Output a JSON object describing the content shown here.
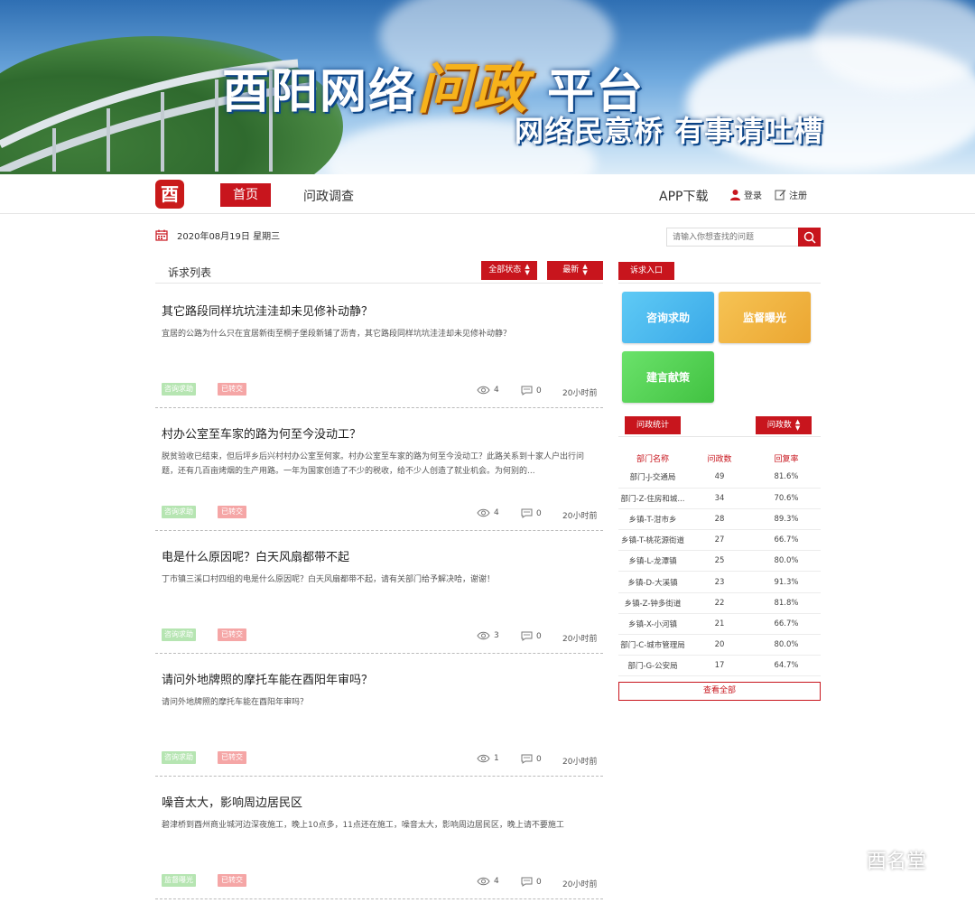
{
  "banner": {
    "title_part1": "酉阳网络",
    "title_highlight": "问政",
    "title_part2": "平台",
    "slogan": "网络民意桥 有事请吐槽"
  },
  "nav": {
    "logo_char": "酉",
    "home": "首页",
    "survey": "问政调查",
    "app_download": "APP下载",
    "login": "登录",
    "register": "注册"
  },
  "date": "2020年08月19日 星期三",
  "search": {
    "placeholder": "请输入你想查找的问题"
  },
  "list": {
    "label": "诉求列表",
    "status_filter": "全部状态",
    "sort": "最新",
    "items": [
      {
        "title": "其它路段同样坑坑洼洼却未见修补动静？",
        "desc": "宜居的公路为什么只在宜居新街至桐子堡段新铺了沥青，其它路段同样坑坑洼洼却未见修补动静？",
        "tag_type": "咨询求助",
        "tag_status": "已转交",
        "views": "4",
        "comments": "0",
        "time": "20小时前"
      },
      {
        "title": "村办公室至车家的路为何至今没动工？",
        "desc": "脱贫验收已结束，但后坪乡后兴村村办公室至何家。村办公室至车家的路为何至今没动工？此路关系到十家人户出行问题，还有几百亩烤烟的生产用路。一年为国家创造了不少的税收，给不少人创造了就业机会。为何别的...",
        "tag_type": "咨询求助",
        "tag_status": "已转交",
        "views": "4",
        "comments": "0",
        "time": "20小时前"
      },
      {
        "title": "电是什么原因呢？白天风扇都带不起",
        "desc": "丁市镇三溪口村四组的电是什么原因呢？白天风扇都带不起，请有关部门给予解决哈，谢谢！",
        "tag_type": "咨询求助",
        "tag_status": "已转交",
        "views": "3",
        "comments": "0",
        "time": "20小时前"
      },
      {
        "title": "请问外地牌照的摩托车能在酉阳年审吗？",
        "desc": "请问外地牌照的摩托车能在酉阳年审吗？",
        "tag_type": "咨询求助",
        "tag_status": "已转交",
        "views": "1",
        "comments": "0",
        "time": "20小时前"
      },
      {
        "title": "噪音太大，影响周边居民区",
        "desc": "碧津桥到酉州商业城河边深夜施工，晚上10点多，11点还在施工，噪音太大，影响周边居民区，晚上请不要施工",
        "tag_type": "监督曝光",
        "tag_status": "已转交",
        "views": "4",
        "comments": "0",
        "time": "20小时前"
      }
    ]
  },
  "sidebar": {
    "entry_label": "诉求入口",
    "cards": [
      "咨询求助",
      "监督曝光",
      "建言献策"
    ],
    "stats_label": "问政统计",
    "stats_sort": "问政数",
    "columns": [
      "部门名称",
      "问政数",
      "回复率"
    ],
    "rows": [
      [
        "部门-J-交通局",
        "49",
        "81.6%"
      ],
      [
        "部门-Z-住房和城...",
        "34",
        "70.6%"
      ],
      [
        "乡镇-T-泔市乡",
        "28",
        "89.3%"
      ],
      [
        "乡镇-T-桃花源街道",
        "27",
        "66.7%"
      ],
      [
        "乡镇-L-龙潭镇",
        "25",
        "80.0%"
      ],
      [
        "乡镇-D-大溪镇",
        "23",
        "91.3%"
      ],
      [
        "乡镇-Z-钟多街道",
        "22",
        "81.8%"
      ],
      [
        "乡镇-X-小河镇",
        "21",
        "66.7%"
      ],
      [
        "部门-C-城市管理局",
        "20",
        "80.0%"
      ],
      [
        "部门-G-公安局",
        "17",
        "64.7%"
      ]
    ],
    "view_all": "查看全部"
  },
  "watermark": "酉名堂",
  "colors": {
    "brand_red": "#c8151d",
    "tag_green": "#b6e5b2",
    "tag_pink": "#f5a6a6"
  }
}
